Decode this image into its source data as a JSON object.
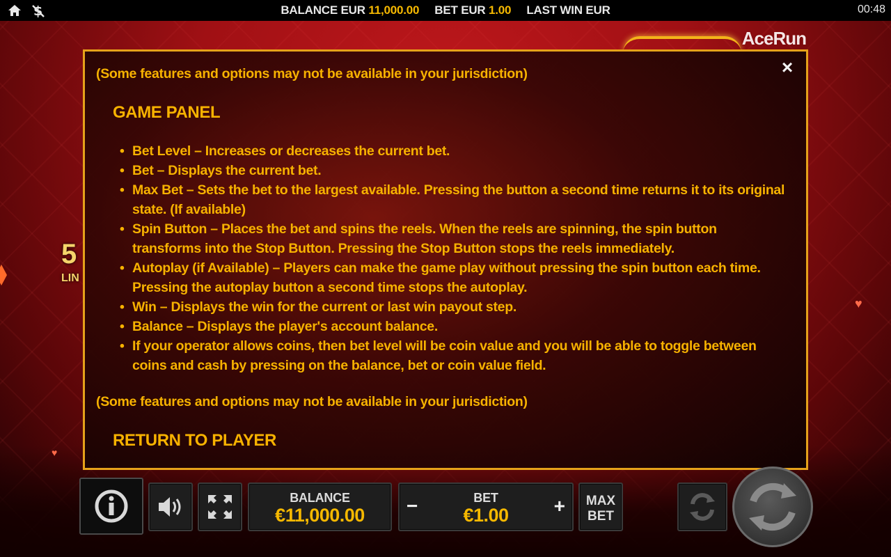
{
  "topbar": {
    "balance_label": "BALANCE EUR",
    "balance_value": "11,000.00",
    "bet_label": "BET EUR",
    "bet_value": "1.00",
    "last_win_label": "LAST WIN EUR",
    "clock": "00:48",
    "home_icon": "home-icon",
    "dollar_icon": "dollar-sign-icon"
  },
  "brand": {
    "logo_text": "AceRun"
  },
  "side_badge": {
    "number": "5",
    "text": "LIN"
  },
  "panel": {
    "disclaimer_top": "(Some features and options may not be available in your jurisdiction)",
    "section_game_panel": "GAME PANEL",
    "bullets": [
      "Bet Level – Increases or decreases the current bet.",
      "Bet – Displays the current bet.",
      "Max Bet – Sets the bet to the largest available. Pressing the button a second time returns it to its original state. (If available)",
      "Spin Button – Places the bet and spins the reels. When the reels are spinning, the spin button transforms into the Stop Button. Pressing the Stop Button stops the reels immediately.",
      "Autoplay (if Available) – Players can make the game play without pressing the spin button each time. Pressing the autoplay button a second time stops the autoplay.",
      "Win – Displays the win for the current or last win payout step.",
      "Balance – Displays the player's account balance.",
      "If your operator allows coins, then bet level will be coin value and you will be able to toggle between coins and cash by pressing on the balance, bet or coin value field."
    ],
    "disclaimer_bottom": "(Some features and options may not be available in your jurisdiction)",
    "section_rtp": "RETURN TO PLAYER",
    "close_symbol": "×"
  },
  "controls": {
    "balance_label": "BALANCE",
    "balance_value": "€11,000.00",
    "bet_label": "BET",
    "bet_value": "€1.00",
    "minus": "−",
    "plus": "+",
    "max_bet_line1": "MAX",
    "max_bet_line2": "BET"
  },
  "colors": {
    "accent_gold": "#f5b800",
    "panel_border": "#e6a21a",
    "background_red": "#a01014"
  }
}
